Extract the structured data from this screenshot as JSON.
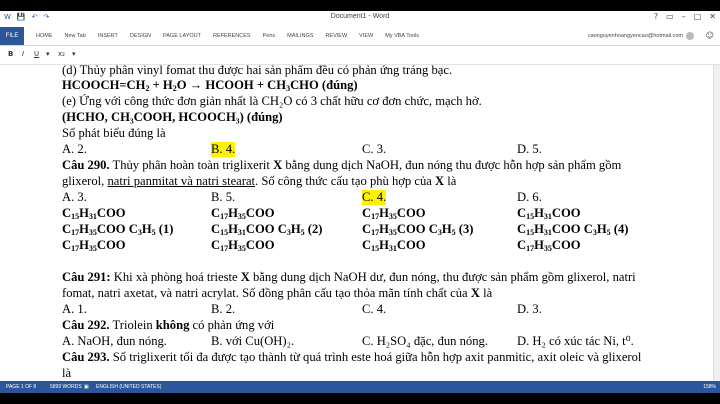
{
  "titlebar": {
    "title": "Document1 - Word",
    "qat": [
      "W",
      "💾",
      "↶",
      "↷"
    ],
    "controls": [
      "?",
      "▭",
      "–",
      "□",
      "✕"
    ]
  },
  "ribbon": {
    "file": "FILE",
    "tabs": [
      "HOME",
      "New Tab",
      "INSERT",
      "DESIGN",
      "PAGE LAYOUT",
      "REFERENCES",
      "Pens",
      "MAILINGS",
      "REVIEW",
      "VIEW",
      "My VBA Tools"
    ],
    "user": "caonguyenhoangyencao@hotmail.com"
  },
  "fmt": {
    "bold": "B",
    "italic": "I",
    "underline": "U",
    "other": "x₂"
  },
  "doc": {
    "l1": "(d) Thủy phân vinyl fomat thu được hai sản phẩm đều có phản ứng tráng  bạc.",
    "l3": "(e) Ứng với công thức đơn giản nhất là CH₂O có 3 chất hữu cơ đơn chức, mạch hở.",
    "l4": "(HCHO, CH₃COOH, HCOOCH₃) (đúng)",
    "l5": "Số phát biểu đúng là",
    "q289": {
      "a": "A. 2.",
      "b": "B. 4.",
      "c": "C. 3.",
      "d": "D. 5."
    },
    "q290_1_label": "Câu 290.",
    "q290_1_text": " Thủy phân hoàn toàn triglixerit ",
    "q290_1_x": "X",
    "q290_1_rest": " bằng dung dịch NaOH, đun nóng thu được hỗn hợp sản phẩm gồm",
    "q290_2a": "glixerol, ",
    "q290_2b": "natri panmitat và natri stearat",
    "q290_2c": ". Số công thức cấu tạo phù hợp của ",
    "q290_2x": "X",
    "q290_2d": " là",
    "q290": {
      "a": "A. 3.",
      "b": "B. 5.",
      "c": "C. 4.",
      "d": "D. 6."
    },
    "q291_label": "Câu 291:",
    "q291_1a": " Khi xà phòng hoá trieste ",
    "q291_1x": "X",
    "q291_1b": " bằng dung dịch NaOH dư, đun nóng, thu được sản phẩm gồm glixerol, natri",
    "q291_2a": "fomat, natri axetat, và natri acrylat. Số đồng phân cấu tạo thỏa mãn tính chất của ",
    "q291_2x": "X",
    "q291_2b": " là",
    "q291": {
      "a": "A. 1.",
      "b": "B. 2.",
      "c": "C. 4.",
      "d": "D. 3."
    },
    "q292_label": "Câu 292.",
    "q292_a": " Triolein ",
    "q292_b": "không",
    "q292_c": " có phản ứng với",
    "q292": {
      "a": "A. NaOH, đun nóng.",
      "b": "B. với Cu(OH)₂.",
      "c": "C. H₂SO₄ đặc, đun nóng.",
      "d": "D. H₂ có xúc tác Ni,  t⁰."
    },
    "q293_label": "Câu 293.",
    "q293_text": " Số triglixerit tối đa được tạo thành từ quá trình este hoá giữa hỗn hợp axit panmitic, axit oleic và glixerol",
    "q293_2": "là"
  },
  "status": {
    "page": "PAGE 1 OF 8",
    "words": "5899 WORDS",
    "lang": "ENGLISH (UNITED STATES)",
    "zoom": "158%"
  }
}
